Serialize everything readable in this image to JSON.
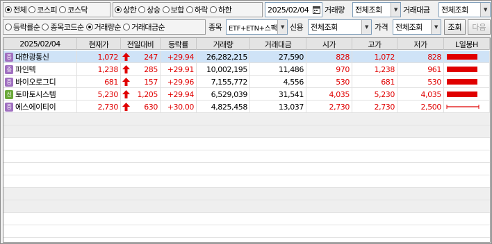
{
  "market_filter": {
    "options": [
      "전체",
      "코스피",
      "코스닥"
    ],
    "selected": 0
  },
  "limit_filter": {
    "options": [
      "상한",
      "상승",
      "보합",
      "하락",
      "하한"
    ],
    "selected": 0
  },
  "date": "2025/02/04",
  "volume_label": "거래량",
  "volume_value": "전체조회",
  "amount_label": "거래대금",
  "amount_value": "전체조회",
  "sort": {
    "options": [
      "등락률순",
      "종목코드순",
      "거래량순",
      "거래대금순"
    ],
    "selected": 2
  },
  "item_label": "종목",
  "item_value": "ETF+ETN+스팩",
  "credit_label": "신용",
  "credit_value": "전체조회",
  "price_label": "가격",
  "price_value": "전체조회",
  "search_button": "조회",
  "next_button": "다음",
  "table": {
    "headers": [
      "2025/02/04",
      "현재가",
      "전일대비",
      "등락률",
      "거래량",
      "거래대금",
      "시가",
      "고가",
      "저가",
      "L일봉H"
    ],
    "rows": [
      {
        "badge": "증",
        "badge_color": "#a070c0",
        "name": "대한광통신",
        "price": "1,072",
        "change": "247",
        "rate": "+29.94",
        "volume": "26,282,215",
        "amount": "27,590",
        "open": "828",
        "high": "1,072",
        "low": "828",
        "selected": true,
        "candle": "bar"
      },
      {
        "badge": "증",
        "badge_color": "#a070c0",
        "name": "파인텍",
        "price": "1,238",
        "change": "285",
        "rate": "+29.91",
        "volume": "10,002,195",
        "amount": "11,486",
        "open": "970",
        "high": "1,238",
        "low": "961",
        "selected": false,
        "candle": "bar"
      },
      {
        "badge": "증",
        "badge_color": "#a070c0",
        "name": "바이오로그디",
        "price": "681",
        "change": "157",
        "rate": "+29.96",
        "volume": "7,155,772",
        "amount": "4,556",
        "open": "530",
        "high": "681",
        "low": "530",
        "selected": false,
        "candle": "bar"
      },
      {
        "badge": "신",
        "badge_color": "#6aa83a",
        "name": "토마토시스템",
        "price": "5,230",
        "change": "1,205",
        "rate": "+29.94",
        "volume": "6,529,039",
        "amount": "31,541",
        "open": "4,035",
        "high": "5,230",
        "low": "4,035",
        "selected": false,
        "candle": "bar"
      },
      {
        "badge": "증",
        "badge_color": "#a070c0",
        "name": "에스에이티이",
        "price": "2,730",
        "change": "630",
        "rate": "+30.00",
        "volume": "4,825,458",
        "amount": "13,037",
        "open": "2,730",
        "high": "2,730",
        "low": "2,500",
        "selected": false,
        "candle": "line"
      }
    ]
  },
  "colors": {
    "up": "#e00000",
    "selected_row": "#cfe3f7",
    "empty_row": "#efefef"
  }
}
